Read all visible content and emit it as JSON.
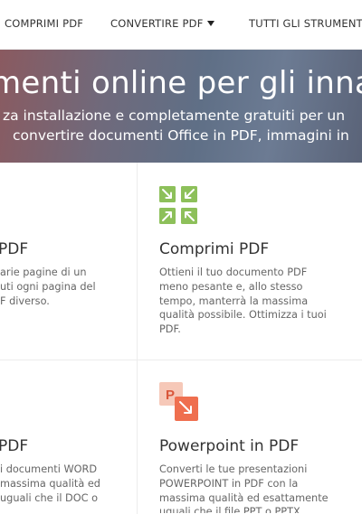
{
  "nav": {
    "compress": "COMPRIMI PDF",
    "convert": "CONVERTIRE PDF",
    "all_tools": "TUTTI GLI STRUMENTI"
  },
  "hero": {
    "title": "menti online per gli innam",
    "subtitle_line1": "za installazione e completamente gratuiti per un",
    "subtitle_line2": "convertire documenti Office in PDF, immagini in"
  },
  "cards": {
    "split": {
      "title": "PDF",
      "desc_lines": [
        "arie pagine di un",
        "uti ogni pagina del",
        "F diverso."
      ]
    },
    "compress": {
      "title": "Comprimi PDF",
      "desc_lines": [
        "Ottieni il tuo documento PDF",
        "meno pesante e, allo stesso",
        "tempo, manterrà la massima",
        "qualità possibile. Ottimizza i tuoi",
        "PDF."
      ]
    },
    "word": {
      "title": "PDF",
      "desc_lines": [
        "i documenti WORD",
        "massima qualità ed",
        "uguali che il DOC o"
      ]
    },
    "powerpoint": {
      "title": "Powerpoint in PDF",
      "desc_lines": [
        "Converti le tue presentazioni",
        "POWERPOINT in PDF con la",
        "massima qualità ed esattamente",
        "uguali che il file PPT o PPTX"
      ]
    }
  },
  "icons": {
    "compress": "compress-arrows-icon",
    "powerpoint": "powerpoint-to-pdf-icon",
    "ppt_letter": "P"
  },
  "colors": {
    "compress_green": "#8dc05a",
    "ppt_orange": "#ef6f4f",
    "ppt_light": "#f6c8b8"
  }
}
